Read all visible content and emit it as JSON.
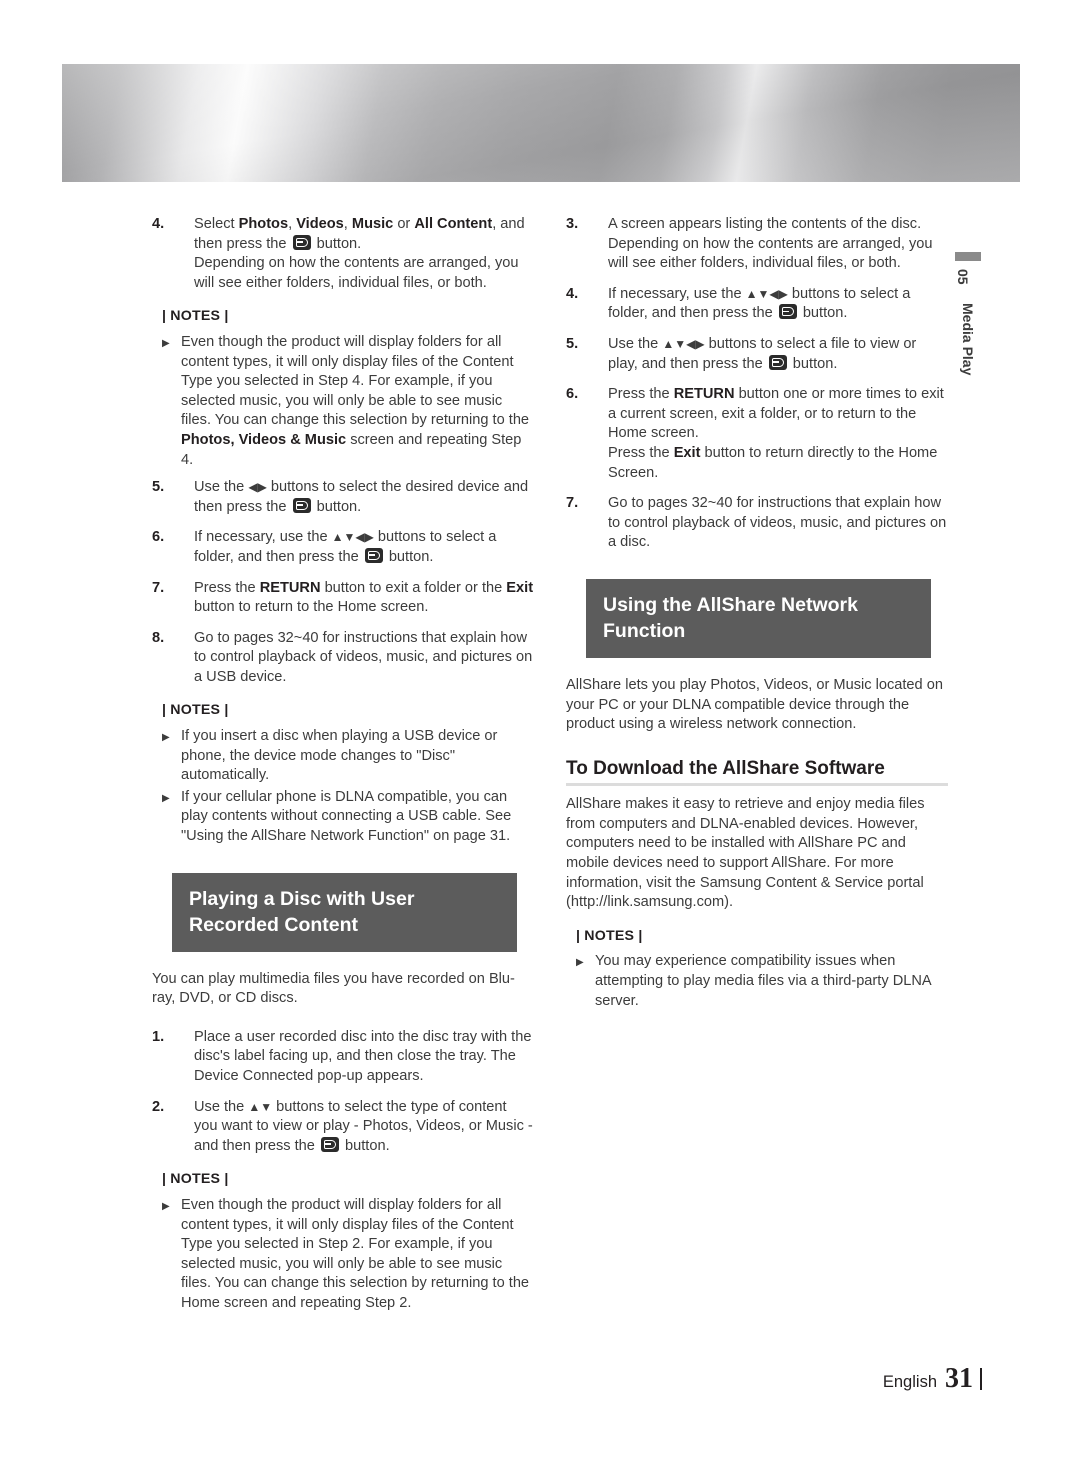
{
  "page": {
    "chapter_number": "05",
    "chapter_name": "Media Play",
    "footer_language": "English",
    "footer_page_number": "31",
    "heading_bar_color": "#5c5c5c",
    "rule_color": "#dcdcdc"
  },
  "left_column": {
    "steps_usb": [
      {
        "num": "4.",
        "lines": [
          "Select |b:Photos|, |b:Videos|, |b:Music| or |b:All Content|, and then press the |icon:enter| button.",
          "Depending on how the contents are arranged, you will see either folders, individual files, or both."
        ]
      }
    ],
    "notes_1": {
      "label": "| NOTES |",
      "items": [
        "Even though the product will display folders for all content types, it will only display files of the Content Type you selected in Step 4. For example, if you selected music, you will only be able to see music files. You can change this selection by returning to the |b:Photos, Videos & Music| screen and repeating Step 4."
      ]
    },
    "steps_usb_cont": [
      {
        "num": "5.",
        "text": "Use the |arrows:◀▶| buttons to select the desired device and then press the |icon:enter| button."
      },
      {
        "num": "6.",
        "text": "If necessary, use the |arrows:▲▼◀▶| buttons to select a folder, and then press the |icon:enter| button."
      },
      {
        "num": "7.",
        "text": "Press the |b:RETURN| button to exit a folder or the |b:Exit| button to return to the Home screen."
      },
      {
        "num": "8.",
        "text": "Go to pages 32~40 for instructions that explain how to control playback of videos, music, and pictures on a USB device."
      }
    ],
    "notes_2": {
      "label": "| NOTES |",
      "items": [
        "If you insert a disc when playing a USB device or phone, the device mode changes to \"Disc\" automatically.",
        "If your cellular phone is DLNA compatible, you can play contents without connecting a USB cable. See \"Using the AllShare Network Function\" on page 31."
      ]
    },
    "section_heading": "Playing a Disc with User Recorded Content",
    "section_intro": "You can play multimedia files you have recorded on Blu-ray, DVD, or CD discs.",
    "steps_disc": [
      {
        "num": "1.",
        "text": "Place a user recorded disc into the disc tray with the disc's label facing up, and then close the tray. The Device Connected pop-up appears."
      },
      {
        "num": "2.",
        "text": "Use the |arrows:▲▼| buttons to select the type of content you want to view or play - Photos, Videos, or Music - and then press the |icon:enter| button."
      }
    ],
    "notes_3": {
      "label": "| NOTES |",
      "items": [
        "Even though the product will display folders for all content types, it will only display files of the Content Type you selected in Step 2. For example, if you selected music, you will only be able to see music files. You can change this selection by returning to the Home screen and repeating Step 2."
      ]
    }
  },
  "right_column": {
    "steps_disc_cont": [
      {
        "num": "3.",
        "text": "A screen appears listing the contents of the disc. Depending on how the contents are arranged, you will see either folders, individual files, or both."
      },
      {
        "num": "4.",
        "text": "If necessary, use the |arrows:▲▼◀▶| buttons to select a folder, and then press the |icon:enter| button."
      },
      {
        "num": "5.",
        "text": "Use the |arrows:▲▼◀▶| buttons to select a file to view or play, and then press the |icon:enter| button."
      },
      {
        "num": "6.",
        "text": "Press the |b:RETURN| button one or more times to exit a current screen, exit a folder, or to return to the Home screen.\nPress the |b:Exit| button to return directly to the Home Screen."
      },
      {
        "num": "7.",
        "text": "Go to pages 32~40 for instructions that explain how to control playback of videos, music, and pictures on a disc."
      }
    ],
    "section_heading": "Using the AllShare Network Function",
    "section_intro": "AllShare lets you play Photos, Videos, or Music located on your PC or your DLNA compatible device through the product using a wireless network connection.",
    "sub_heading": "To Download the AllShare Software",
    "sub_body": "AllShare makes it easy to retrieve and enjoy media files from computers and DLNA-enabled devices. However, computers need to be installed with AllShare PC and mobile devices need to support AllShare. For more information, visit the Samsung Content & Service portal (http://link.samsung.com).",
    "notes": {
      "label": "| NOTES |",
      "items": [
        "You may experience compatibility issues when attempting to play media files via a third-party DLNA server."
      ]
    }
  }
}
